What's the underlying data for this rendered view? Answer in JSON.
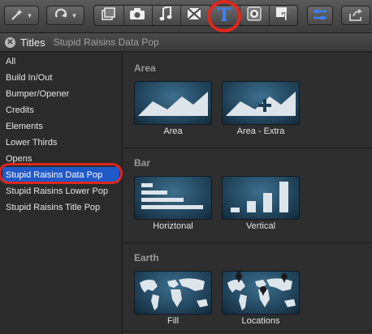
{
  "header": {
    "panel_title": "Titles",
    "selected_category": "Stupid Raisins Data Pop"
  },
  "toolbar": {
    "icons": [
      "magic-wand-icon",
      "rotate-icon",
      "clips-icon",
      "photo-icon",
      "music-icon",
      "transition-icon",
      "titles-icon",
      "generator-icon",
      "themes-icon",
      "list-toggle-icon",
      "share-icon"
    ],
    "accent": "#3d7fff",
    "highlight": "#e0261c"
  },
  "sidebar": {
    "items": [
      {
        "label": "All"
      },
      {
        "label": "Build In/Out"
      },
      {
        "label": "Bumper/Opener"
      },
      {
        "label": "Credits"
      },
      {
        "label": "Elements"
      },
      {
        "label": "Lower Thirds"
      },
      {
        "label": "Opens"
      },
      {
        "label": "Stupid Raisins Data Pop"
      },
      {
        "label": "Stupid Raisins Lower Pop"
      },
      {
        "label": "Stupid Raisins Title Pop"
      }
    ],
    "selected_index": 7,
    "selected_color": "#1f58c7"
  },
  "main": {
    "sections": [
      {
        "title": "Area",
        "items": [
          {
            "label": "Area"
          },
          {
            "label": "Area - Extra"
          }
        ]
      },
      {
        "title": "Bar",
        "items": [
          {
            "label": "Horiztonal"
          },
          {
            "label": "Vertical"
          }
        ]
      },
      {
        "title": "Earth",
        "items": [
          {
            "label": "Fill"
          },
          {
            "label": "Locations"
          }
        ]
      }
    ]
  }
}
